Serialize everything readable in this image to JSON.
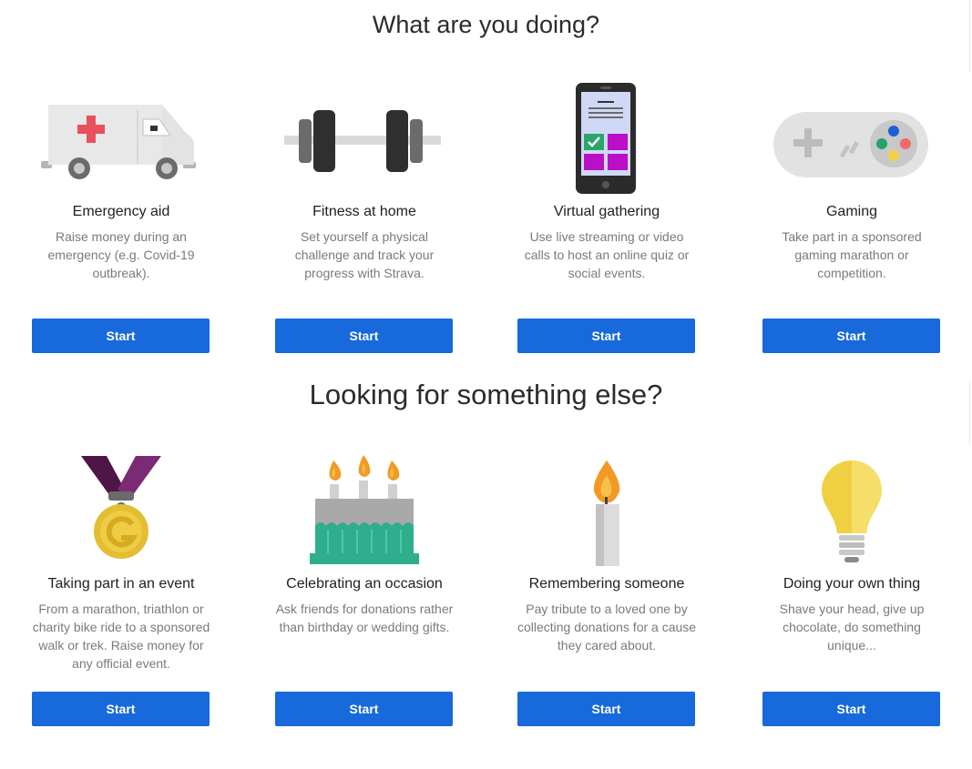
{
  "sections": [
    {
      "title": "What are you doing?",
      "cards": [
        {
          "title": "Emergency aid",
          "description": "Raise money during an emergency (e.g. Covid-19 outbreak).",
          "button": "Start"
        },
        {
          "title": "Fitness at home",
          "description": "Set yourself a physical challenge and track your progress with Strava.",
          "button": "Start"
        },
        {
          "title": "Virtual gathering",
          "description": "Use live streaming or video calls to host an online quiz or social events.",
          "button": "Start"
        },
        {
          "title": "Gaming",
          "description": "Take part in a sponsored gaming marathon or competition.",
          "button": "Start"
        }
      ]
    },
    {
      "title": "Looking for something else?",
      "cards": [
        {
          "title": "Taking part in an event",
          "description": "From a marathon, triathlon or charity bike ride to a sponsored walk or trek. Raise money for any official event.",
          "button": "Start"
        },
        {
          "title": "Celebrating an occasion",
          "description": "Ask friends for donations rather than birthday or wedding gifts.",
          "button": "Start"
        },
        {
          "title": "Remembering someone",
          "description": "Pay tribute to a loved one by collecting donations for a cause they cared about.",
          "button": "Start"
        },
        {
          "title": "Doing your own thing",
          "description": "Shave your head, give up chocolate, do something unique...",
          "button": "Start"
        }
      ]
    }
  ],
  "icons": [
    "ambulance-icon",
    "dumbbell-icon",
    "phone-icon",
    "gamepad-icon",
    "medal-icon",
    "birthday-cake-icon",
    "candle-icon",
    "lightbulb-icon"
  ],
  "colors": {
    "button": "#1769dc",
    "button_text": "#ffffff",
    "title_text": "#2b2b2b",
    "description_text": "#7a7a7a"
  }
}
